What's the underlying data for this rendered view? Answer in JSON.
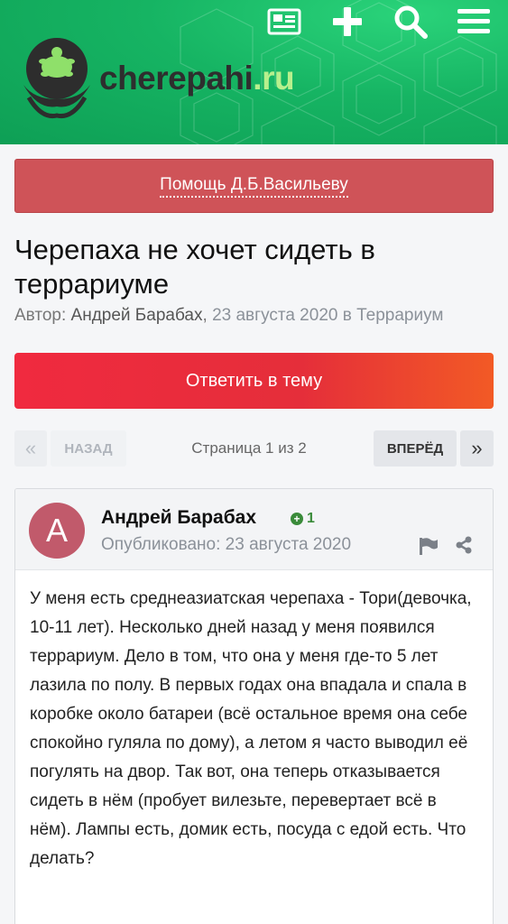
{
  "header": {
    "logo_text_main": "cherepahi",
    "logo_text_tld": ".ru",
    "icons": [
      "news-icon",
      "plus-icon",
      "search-icon",
      "menu-icon"
    ]
  },
  "help_banner": {
    "label": "Помощь Д.Б.Васильеву"
  },
  "topic": {
    "title": "Черепаха не хочет сидеть в террариуме",
    "byline_prefix": "Автор: ",
    "author": "Андрей Барабах",
    "comma": ", ",
    "date": "23 августа 2020",
    "in_word": " в ",
    "category": "Террариум"
  },
  "reply_button": {
    "label": "Ответить в тему"
  },
  "pagination": {
    "prev_arrow": "«",
    "prev_label": "НАЗАД",
    "page_info": "Страница 1 из 2",
    "next_label": "ВПЕРЁД",
    "next_arrow": "»"
  },
  "post": {
    "avatar_letter": "A",
    "author": "Андрей Барабах",
    "reputation": "1",
    "published": "Опубликовано: 23 августа 2020",
    "body": "У меня есть среднеазиатская черепаха - Тори(девочка, 10-11 лет). Несколько дней назад у меня появился террариум. Дело в том, что она у меня где-то 5 лет лазила по полу. В первых годах она впадала и спала в коробке около батареи (всё остальное время она себе спокойно гуляла по дому), а летом я часто выводил её погулять на двор. Так вот, она теперь отказывается сидеть в нём (пробует вилезьте, перевертает всё в нём). Лампы есть, домик есть, посуда с едой есть. Что делать?"
  },
  "colors": {
    "header_green": "#16b463",
    "banner_red": "#cf5358",
    "reply_gradient_start": "#f02a3f",
    "reply_gradient_end": "#f25a25",
    "avatar": "#c15a6b",
    "reputation_green": "#3a8b3a"
  }
}
